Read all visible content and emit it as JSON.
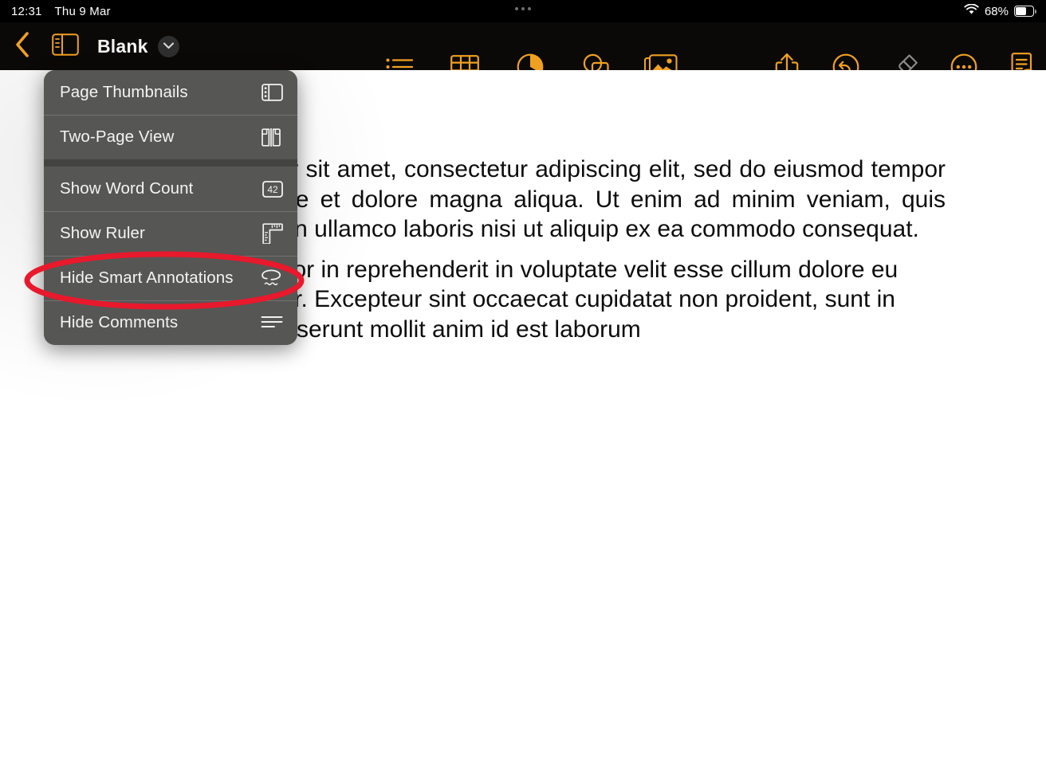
{
  "status_bar": {
    "time": "12:31",
    "date": "Thu 9 Mar",
    "battery_percent": "68%",
    "wifi_icon": "wifi-icon",
    "battery_icon": "battery-icon",
    "dots_icon": "multitask-dots-icon"
  },
  "toolbar": {
    "back_icon": "chevron-left-icon",
    "sidebar_icon": "sidebar-toggle-icon",
    "document_title": "Blank",
    "title_chevron_icon": "chevron-down-icon",
    "accent_color": "#f0a021",
    "center_tools": [
      {
        "name": "insert-list-button",
        "icon": "bulleted-list-icon"
      },
      {
        "name": "insert-table-button",
        "icon": "table-icon"
      },
      {
        "name": "insert-chart-button",
        "icon": "pie-chart-icon"
      },
      {
        "name": "insert-shape-button",
        "icon": "shapes-icon"
      },
      {
        "name": "insert-media-button",
        "icon": "photo-media-icon"
      }
    ],
    "right_tools": [
      {
        "name": "share-button",
        "icon": "share-up-arrow-icon",
        "enabled": true
      },
      {
        "name": "undo-button",
        "icon": "undo-circle-arrow-icon",
        "enabled": true
      },
      {
        "name": "format-brush-button",
        "icon": "paint-brush-icon",
        "enabled": false
      },
      {
        "name": "more-options-button",
        "icon": "ellipsis-circle-icon",
        "enabled": true
      },
      {
        "name": "document-view-button",
        "icon": "document-eye-icon",
        "enabled": true
      }
    ]
  },
  "menu": {
    "groups": [
      {
        "items": [
          {
            "label": "Page Thumbnails",
            "icon": "page-thumbnails-icon"
          },
          {
            "label": "Two-Page View",
            "icon": "two-page-view-icon"
          }
        ]
      },
      {
        "items": [
          {
            "label": "Show Word Count",
            "icon": "word-count-42-icon"
          },
          {
            "label": "Show Ruler",
            "icon": "ruler-icon"
          },
          {
            "label": "Hide Smart Annotations",
            "icon": "smart-annotation-icon"
          },
          {
            "label": "Hide Comments",
            "icon": "comments-lines-icon"
          }
        ]
      }
    ]
  },
  "annotation": {
    "shape": "ellipse",
    "color": "#e8192c",
    "targets": "Hide Smart Annotations"
  },
  "document": {
    "paragraphs": [
      "Lorem ipsum dolor sit amet, consectetur adipiscing elit, sed do eiusmod tempor incididunt ut labore et dolore magna aliqua. Ut enim ad minim veniam, quis nostrud exercitation ullamco laboris nisi ut aliquip ex ea commodo consequat.",
      "Duis aute irure dolor in reprehenderit in voluptate velit esse cillum dolore eu fugiat nulla pariatur. Excepteur sint occaecat cupidatat non proident, sunt in culpa qui officia deserunt mollit anim id est laborum"
    ]
  }
}
